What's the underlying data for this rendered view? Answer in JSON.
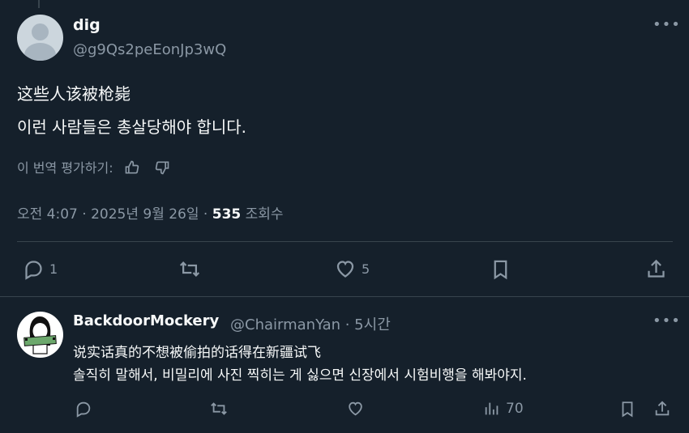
{
  "post": {
    "name": "dig",
    "handle": "@g9Qs2peEonJp3wQ",
    "text_line1": "这些人该被枪毙",
    "text_line2": "이런 사람들은 총살당해야 합니다.",
    "translate_prompt": "이 번역 평가하기:",
    "timestamp": "오전 4:07 · 2025년 9월 26일 · ",
    "views_count": "535",
    "views_label": " 조회수",
    "actions": {
      "reply_count": "1",
      "repost_count": "",
      "like_count": "5"
    }
  },
  "reply": {
    "name": "BackdoorMockery",
    "handle_time": "@ChairmanYan · 5시간",
    "text_line1": "说实话真的不想被偷拍的话得在新疆试飞",
    "text_line2": "솔직히 말해서, 비밀리에 사진 찍히는 게 싫으면 신장에서 시험비행을 해봐야지.",
    "actions": {
      "views_count": "70"
    }
  },
  "icons": [
    "more-icon",
    "thumbs-up-icon",
    "thumbs-down-icon",
    "reply-icon",
    "repost-icon",
    "like-icon",
    "bookmark-icon",
    "share-icon",
    "analytics-icon"
  ],
  "colors": {
    "background": "#15202b",
    "text": "#f7f9f9",
    "muted": "#8b98a5",
    "divider": "#38444d"
  }
}
